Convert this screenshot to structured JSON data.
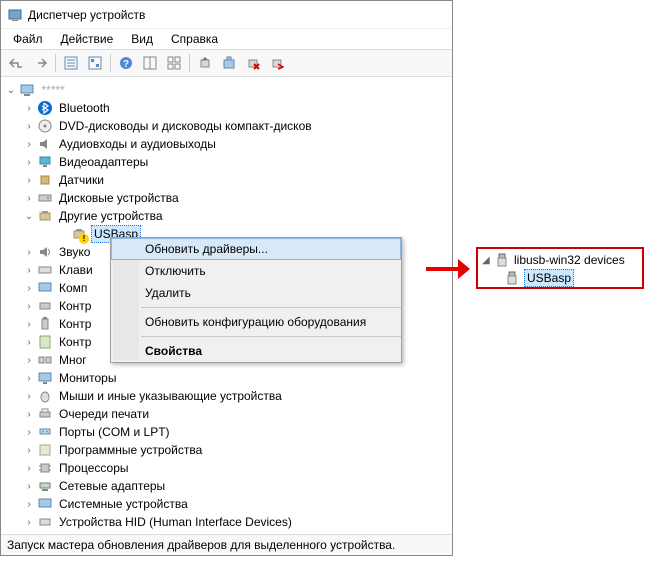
{
  "window": {
    "title": "Диспетчер устройств"
  },
  "menubar": {
    "file": "Файл",
    "action": "Действие",
    "view": "Вид",
    "help": "Справка"
  },
  "tree": {
    "root": "*****",
    "bluetooth": "Bluetooth",
    "dvd": "DVD-дисководы и дисководы компакт-дисков",
    "audio": "Аудиовходы и аудиовыходы",
    "video": "Видеоадаптеры",
    "sensors": "Датчики",
    "disks": "Дисковые устройства",
    "other": "Другие устройства",
    "usbasp": "USBasp",
    "sound": "Звуко",
    "keyboard": "Клави",
    "computer": "Комп",
    "controllers1": "Контр",
    "controllers2": "Контр",
    "controllers3": "Контр",
    "multi": "Мног",
    "monitors": "Мониторы",
    "mice": "Мыши и иные указывающие устройства",
    "printqueue": "Очереди печати",
    "ports": "Порты (COM и LPT)",
    "software": "Программные устройства",
    "cpu": "Процессоры",
    "network": "Сетевые адаптеры",
    "system": "Системные устройства",
    "hid": "Устройства HID (Human Interface Devices)"
  },
  "context_menu": {
    "update_drivers": "Обновить драйверы...",
    "disable": "Отключить",
    "delete": "Удалить",
    "refresh_config": "Обновить конфигурацию оборудования",
    "properties": "Свойства"
  },
  "result": {
    "libusb": "libusb-win32 devices",
    "usbasp": "USBasp"
  },
  "statusbar": {
    "text": "Запуск мастера обновления драйверов для выделенного устройства."
  }
}
